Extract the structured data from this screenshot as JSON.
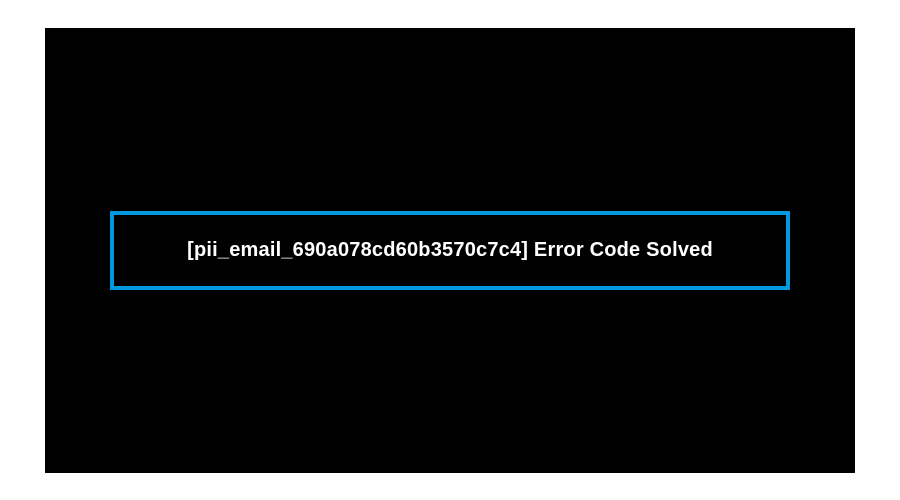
{
  "panel": {
    "border_color": "#0099dd",
    "background_color": "#000000",
    "text_color": "#ffffff",
    "message": "[pii_email_690a078cd60b3570c7c4] Error Code Solved"
  }
}
